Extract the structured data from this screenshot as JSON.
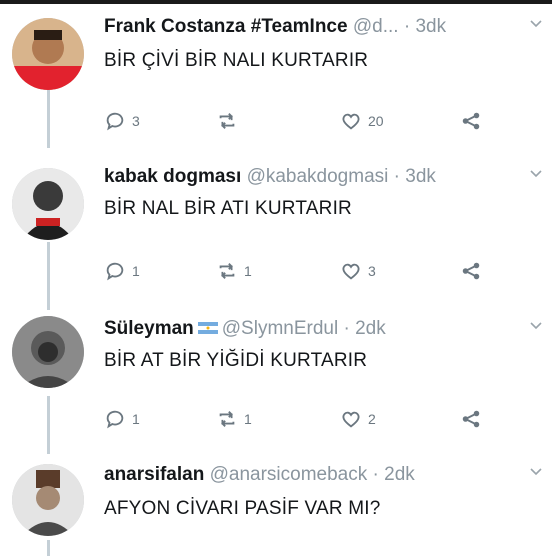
{
  "tweets": [
    {
      "name": "Frank Costanza #TeamInce",
      "handle": "@d...",
      "time": "· 3dk",
      "text": "BİR ÇİVİ BİR NALI KURTARIR",
      "reply_count": "3",
      "retweet_count": "",
      "like_count": "20"
    },
    {
      "name": "kabak dogması",
      "handle": "@kabakdogmasi",
      "time": "· 3dk",
      "text": "BİR NAL BİR ATI KURTARIR",
      "reply_count": "1",
      "retweet_count": "1",
      "like_count": "3"
    },
    {
      "name": "Süleyman",
      "handle": "@SlymnErdul",
      "time": "· 2dk",
      "text": "BİR AT BİR YİĞİDİ KURTARIR",
      "reply_count": "1",
      "retweet_count": "1",
      "like_count": "2"
    },
    {
      "name": "anarsifalan",
      "handle": "@anarsicomeback",
      "time": "· 2dk",
      "text": "AFYON CİVARI PASİF VAR MI?"
    }
  ],
  "colors": {
    "name": "#14171a",
    "handle": "#8a959e",
    "icon": "#6b7780",
    "thread_line": "#c4cfd6",
    "flag_blue": "#74acdf"
  }
}
